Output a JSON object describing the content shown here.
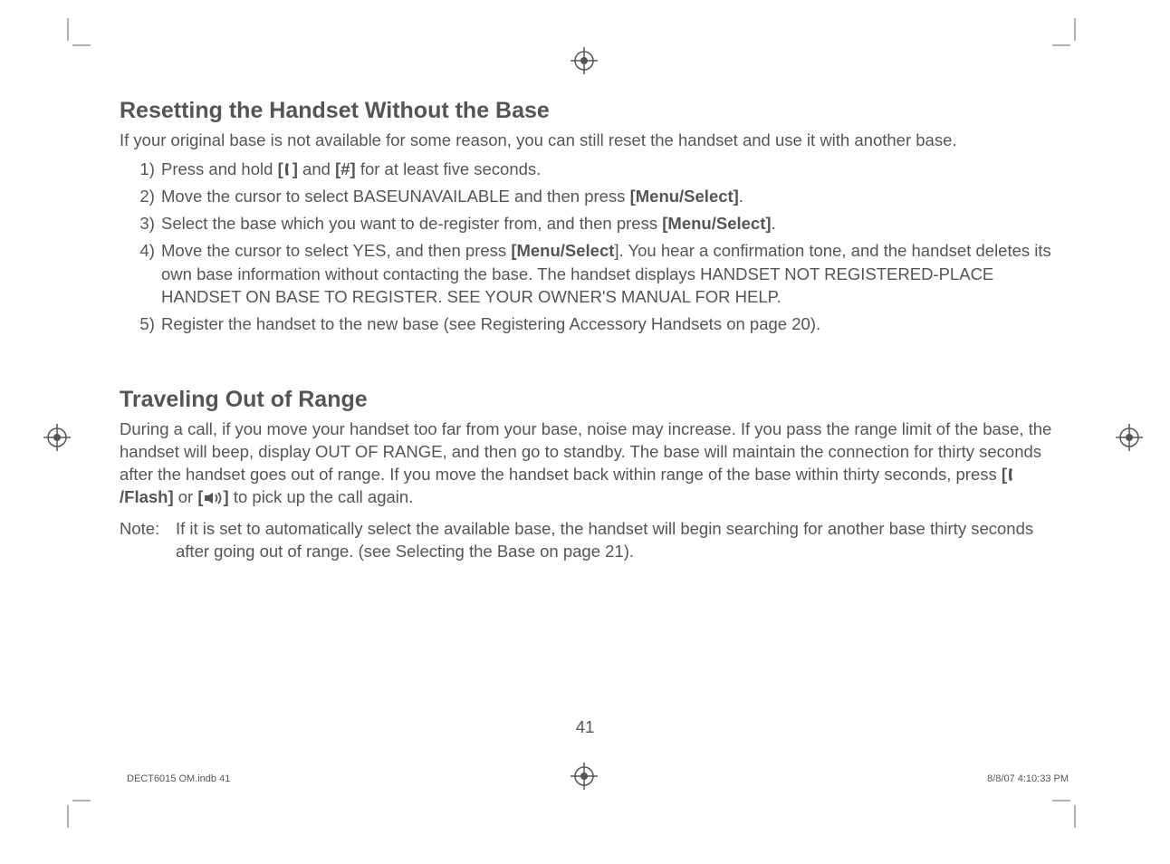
{
  "section1": {
    "heading": "Resetting the Handset Without the Base",
    "intro": "If your original base is not available for some reason, you can still reset the handset and use it with another base.",
    "steps": {
      "s1_a": "Press and hold ",
      "s1_b": " and ",
      "s1_hash": "[#]",
      "s1_c": " for at least five seconds.",
      "s2_a": "Move the cursor to select BASEUNAVAILABLE and then press ",
      "s2_b": "[Menu/Select]",
      "s2_c": ".",
      "s3_a": "Select the base which you want to de-register from, and then press ",
      "s3_b": "[Menu/Select]",
      "s3_c": ".",
      "s4_a": "Move the cursor to select YES, and then press ",
      "s4_b": "[Menu/Select",
      "s4_c": "]. You hear a confirmation tone, and the handset deletes its own base information without contacting the base. The handset displays HANDSET NOT REGISTERED-PLACE HANDSET ON BASE TO REGISTER. SEE YOUR OWNER'S MANUAL FOR HELP.",
      "s5": "Register the handset to the new base (see Registering Accessory Handsets on page 20)."
    }
  },
  "section2": {
    "heading": "Traveling Out of Range",
    "body_a": "During a call, if you move your handset too far from your base, noise may increase. If you pass the range limit of the base, the handset will beep, display OUT OF RANGE, and then go to standby. The base will maintain the connection for thirty seconds after the handset goes out of range. If you move the handset back within range of the base within thirty seconds, press ",
    "flash_label": "/Flash]",
    "body_b": " or ",
    "body_c": " to pick up the call again.",
    "note_label": "Note:",
    "note_body": "If it is set to automatically select the available base, the handset will begin searching for another base thirty seconds after going out of range. (see Selecting the Base on page 21)."
  },
  "page_number": "41",
  "footer_left": "DECT6015 OM.indb   41",
  "footer_right": "8/8/07   4:10:33 PM",
  "icons": {
    "phone_bracket_open": "[",
    "phone_bracket_close": "]",
    "speaker_bracket_open": "[",
    "speaker_bracket_close": "]",
    "flash_bracket_open": "["
  }
}
